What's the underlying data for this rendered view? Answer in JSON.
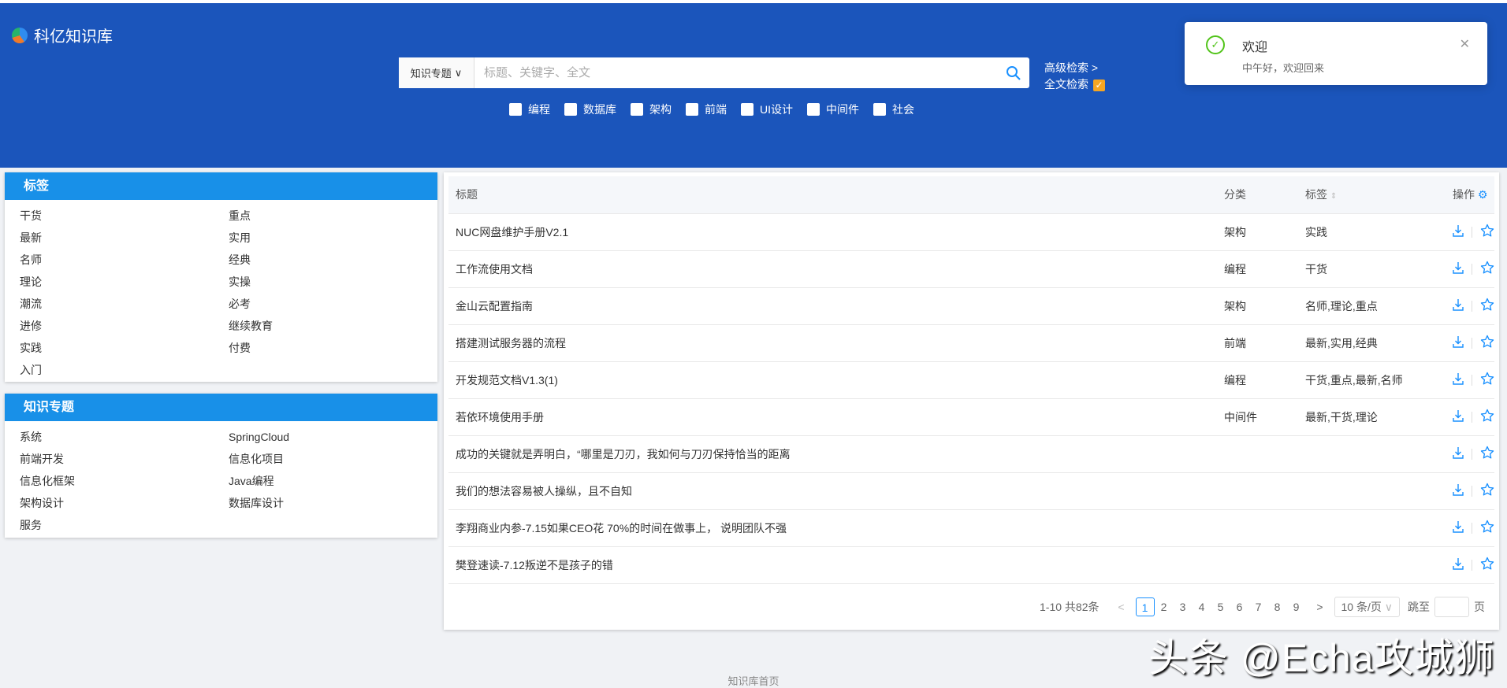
{
  "header": {
    "logo": "科亿知识库",
    "scope": "知识专题",
    "placeholder": "标题、关键字、全文",
    "advanced": "高级检索  >",
    "fulltext": "全文检索",
    "categories": [
      "编程",
      "数据库",
      "架构",
      "前端",
      "UI设计",
      "中间件",
      "社会"
    ]
  },
  "toast": {
    "title": "欢迎",
    "desc": "中午好，欢迎回来"
  },
  "tags": {
    "title": "标签",
    "items": [
      "干货",
      "重点",
      "最新",
      "实用",
      "名师",
      "经典",
      "理论",
      "实操",
      "潮流",
      "必考",
      "进修",
      "继续教育",
      "实践",
      "付费",
      "入门"
    ]
  },
  "topics": {
    "title": "知识专题",
    "items": [
      "系统",
      "SpringCloud",
      "前端开发",
      "信息化项目",
      "信息化框架",
      "Java编程",
      "架构设计",
      "数据库设计",
      "服务"
    ]
  },
  "table": {
    "headers": [
      "标题",
      "分类",
      "标签",
      "操作"
    ],
    "rows": [
      [
        "NUC网盘维护手册V2.1",
        "架构",
        "实践"
      ],
      [
        "工作流使用文档",
        "编程",
        "干货"
      ],
      [
        "金山云配置指南",
        "架构",
        "名师,理论,重点"
      ],
      [
        "搭建测试服务器的流程",
        "前端",
        "最新,实用,经典"
      ],
      [
        "开发规范文档V1.3(1)",
        "编程",
        "干货,重点,最新,名师"
      ],
      [
        "若依环境使用手册",
        "中间件",
        "最新,干货,理论"
      ],
      [
        "成功的关键就是弄明白，“哪里是刀刃，我如何与刀刃保持恰当的距离",
        "",
        ""
      ],
      [
        "我们的想法容易被人操纵，且不自知",
        "",
        ""
      ],
      [
        "李翔商业内参-7.15如果CEO花 70%的时间在做事上， 说明团队不强",
        "",
        ""
      ],
      [
        "樊登速读-7.12叛逆不是孩子的错",
        "",
        ""
      ]
    ]
  },
  "pager": {
    "total": "1-10 共82条",
    "pages": [
      "1",
      "2",
      "3",
      "4",
      "5",
      "6",
      "7",
      "8",
      "9"
    ],
    "current": "1",
    "size": "10 条/页",
    "jump": "跳至",
    "page": "页"
  },
  "watermark": "头条 @Echa攻城狮",
  "footer": "知识库首页",
  "colors": {
    "header": "#1b55bb",
    "panel_header": "#1890e8",
    "accent": "#1890ff"
  }
}
